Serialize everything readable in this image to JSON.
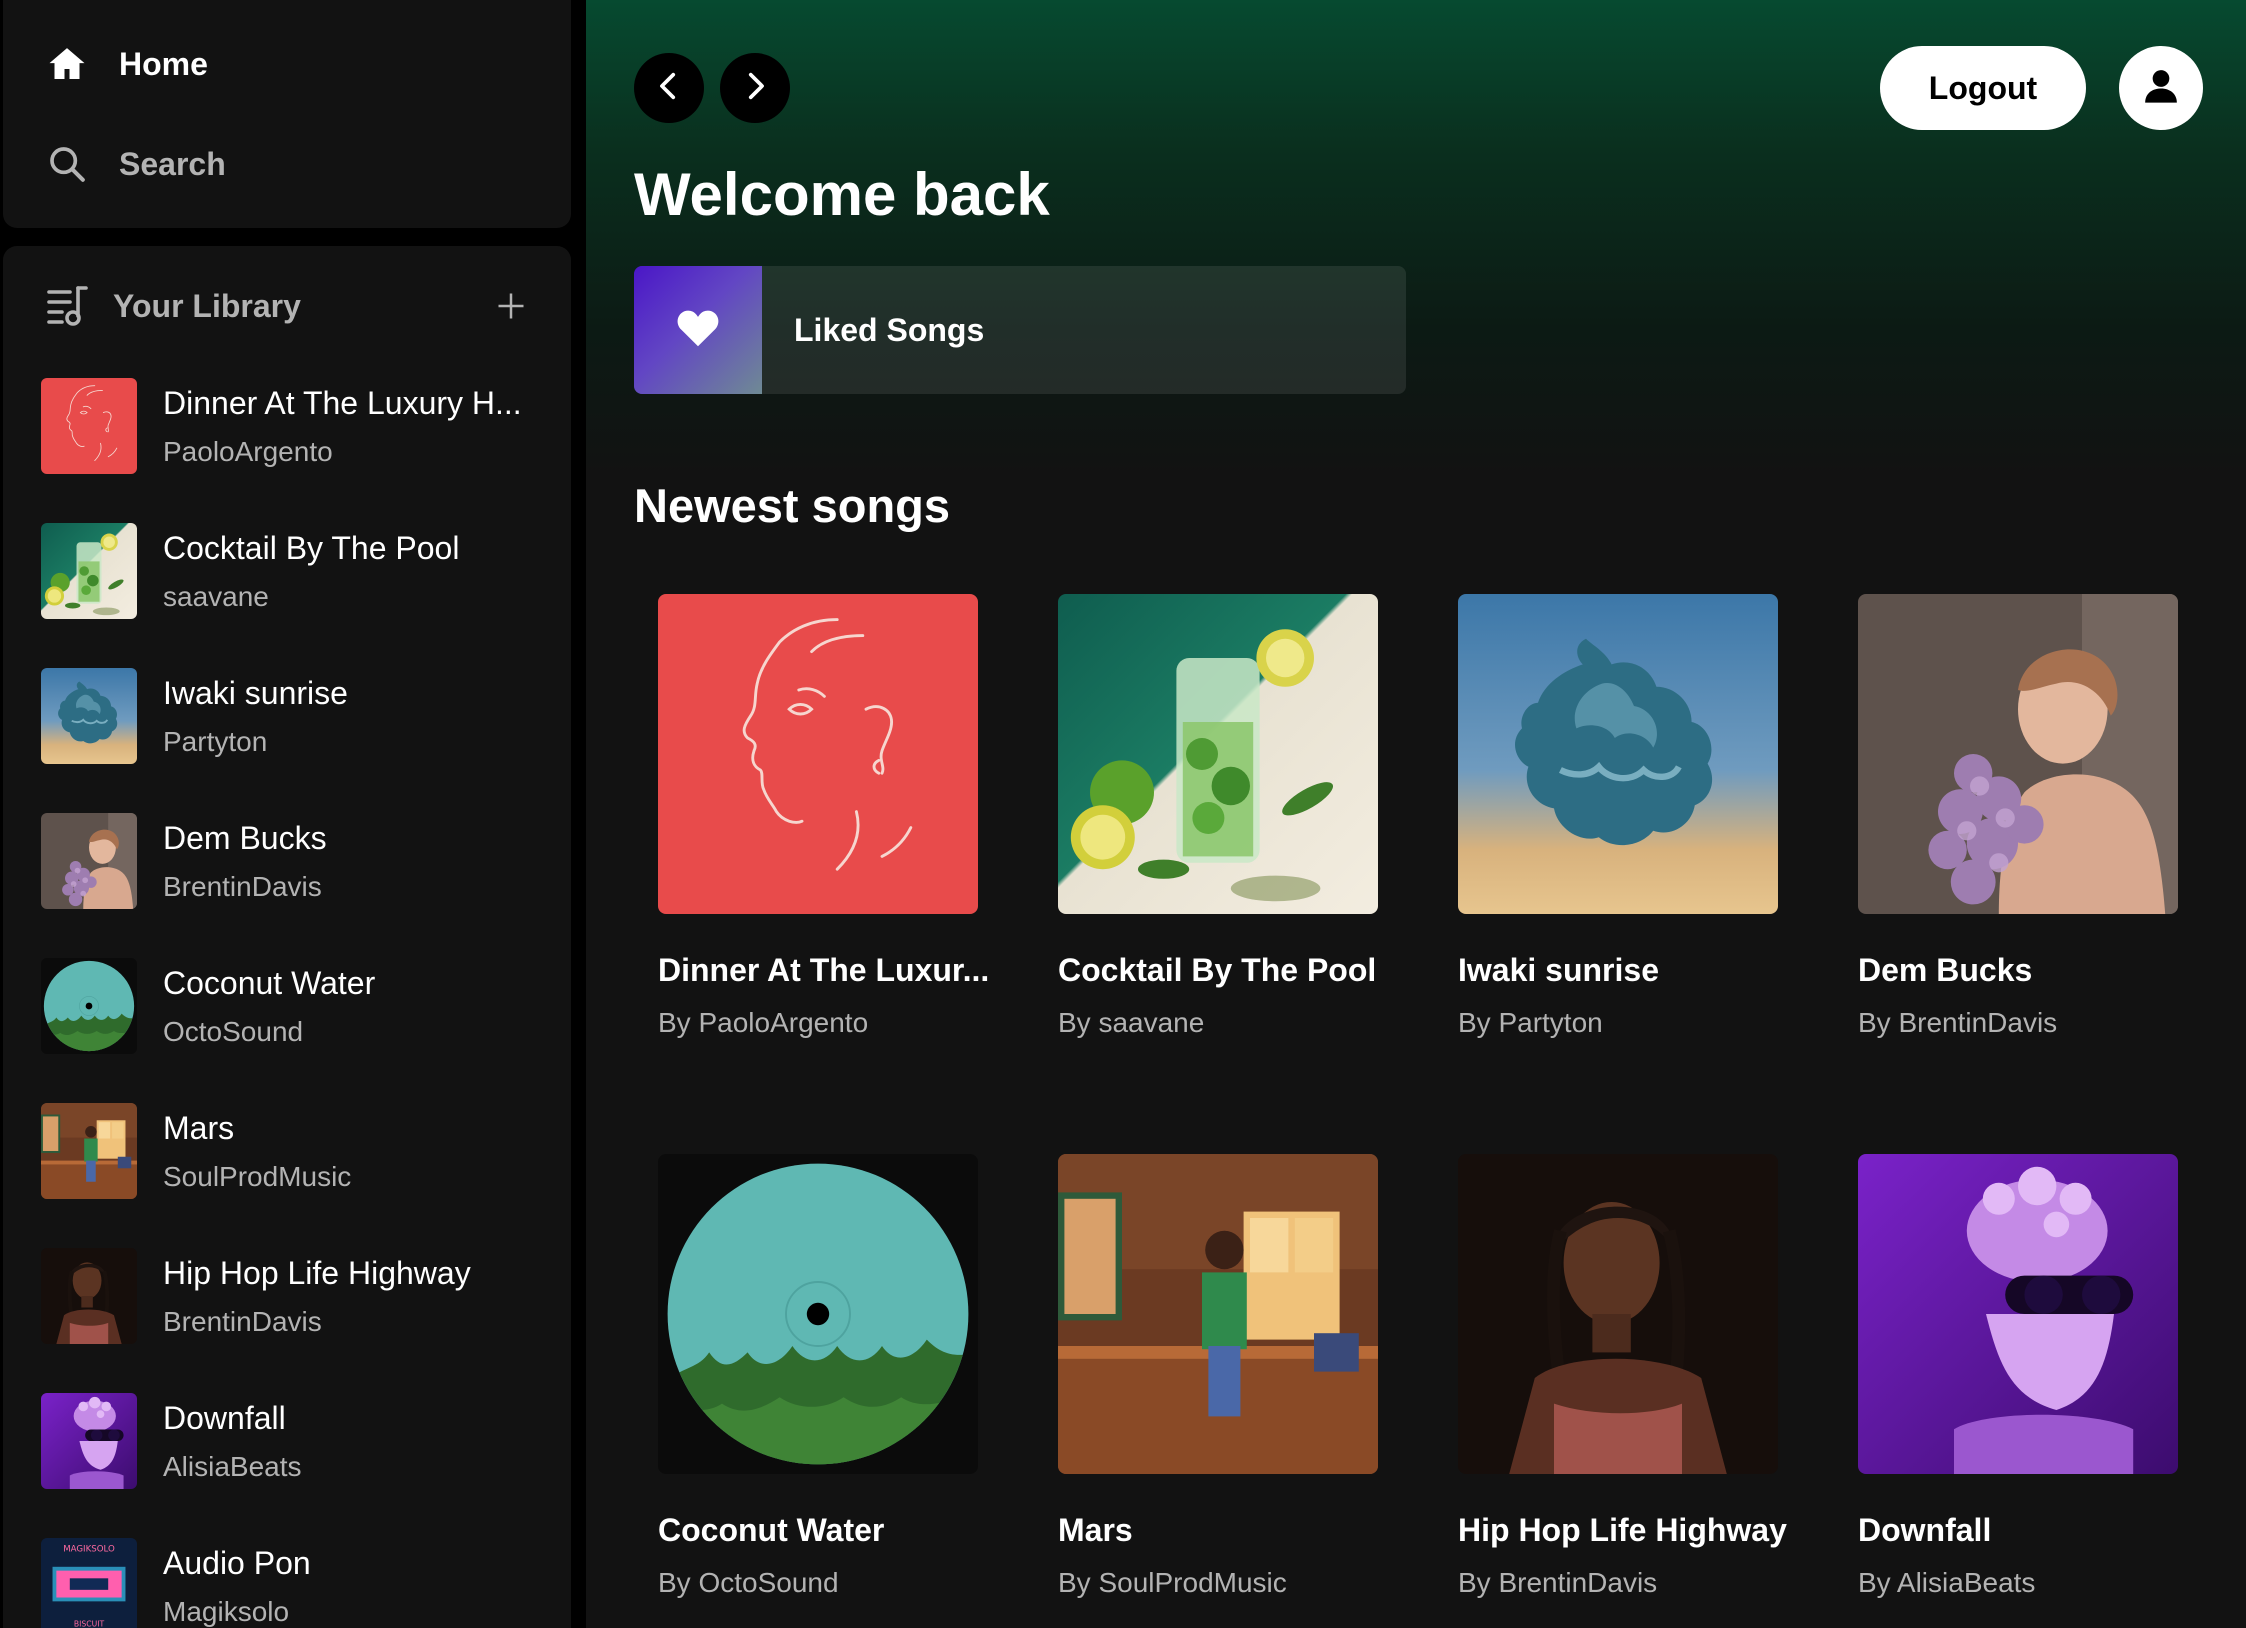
{
  "sidebar": {
    "home_label": "Home",
    "search_label": "Search",
    "library_title": "Your Library",
    "library_items": [
      {
        "name": "Dinner At The Luxury H...",
        "artist": "PaoloArgento",
        "art": "line-face"
      },
      {
        "name": "Cocktail By The Pool",
        "artist": "saavane",
        "art": "cocktail"
      },
      {
        "name": "Iwaki sunrise",
        "artist": "Partyton",
        "art": "cloud"
      },
      {
        "name": "Dem Bucks",
        "artist": "BrentinDavis",
        "art": "portrait-flowers"
      },
      {
        "name": "Coconut Water",
        "artist": "OctoSound",
        "art": "vinyl-palms"
      },
      {
        "name": "Mars",
        "artist": "SoulProdMusic",
        "art": "kitchen"
      },
      {
        "name": "Hip Hop Life Highway",
        "artist": "BrentinDavis",
        "art": "portrait-dark"
      },
      {
        "name": "Downfall",
        "artist": "AlisiaBeats",
        "art": "statue-purple"
      },
      {
        "name": "Audio Pon",
        "artist": "Magiksolo",
        "art": "magiksolo",
        "art_text_top": "MAGIKSOLO",
        "art_text_bottom": "BISCUIT"
      }
    ]
  },
  "header": {
    "logout_label": "Logout"
  },
  "main": {
    "welcome": "Welcome back",
    "liked_songs_label": "Liked Songs",
    "newest_title": "Newest songs",
    "songs": [
      {
        "title": "Dinner At The Luxur...",
        "artist": "By PaoloArgento",
        "art": "line-face"
      },
      {
        "title": "Cocktail By The Pool",
        "artist": "By saavane",
        "art": "cocktail"
      },
      {
        "title": "Iwaki sunrise",
        "artist": "By Partyton",
        "art": "cloud"
      },
      {
        "title": "Dem Bucks",
        "artist": "By BrentinDavis",
        "art": "portrait-flowers"
      },
      {
        "title": "Coconut Water",
        "artist": "By OctoSound",
        "art": "vinyl-palms"
      },
      {
        "title": "Mars",
        "artist": "By SoulProdMusic",
        "art": "kitchen"
      },
      {
        "title": "Hip Hop Life Highway",
        "artist": "By BrentinDavis",
        "art": "portrait-dark"
      },
      {
        "title": "Downfall",
        "artist": "By AlisiaBeats",
        "art": "statue-purple"
      }
    ]
  },
  "colors": {
    "accent_green": "#064a30",
    "surface": "#121212",
    "text_secondary": "#b3b3b3"
  },
  "icons": [
    "home-icon",
    "search-icon",
    "library-icon",
    "plus-icon",
    "chevron-left-icon",
    "chevron-right-icon",
    "user-icon",
    "heart-icon"
  ]
}
